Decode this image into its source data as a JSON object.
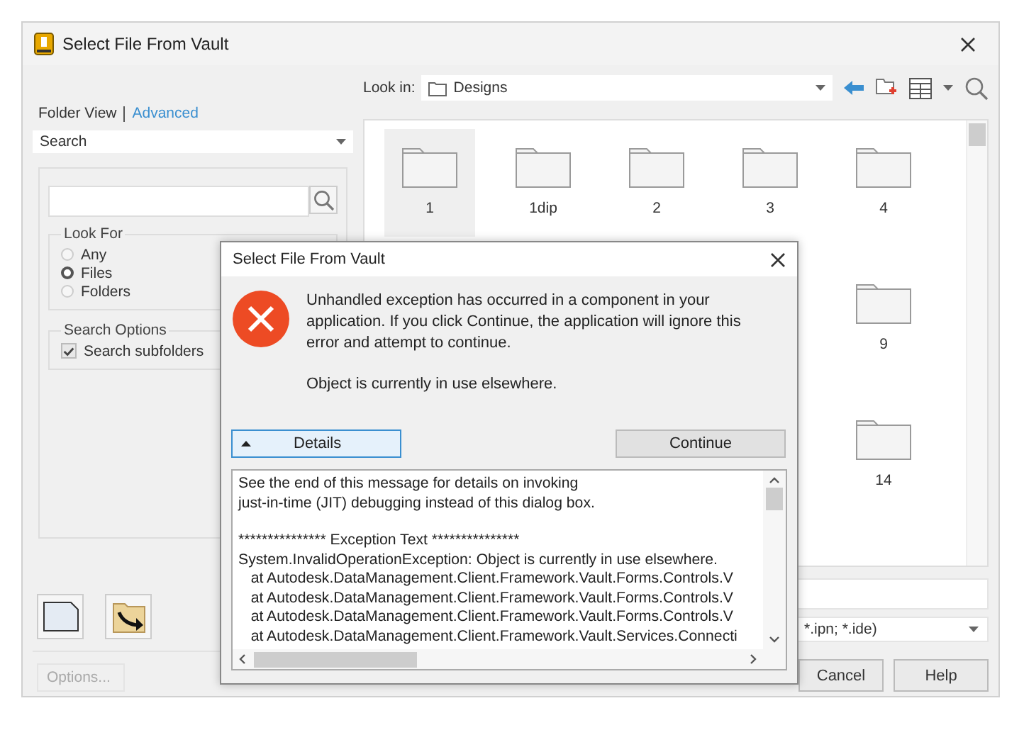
{
  "window": {
    "title": "Select File From Vault"
  },
  "left_panel": {
    "view_links": [
      {
        "label": "Folder View",
        "selected": true
      },
      {
        "label": "Advanced",
        "selected": false
      }
    ],
    "search_mode": "Search",
    "look_for": {
      "title": "Look For",
      "options": [
        {
          "label": "Any",
          "selected": false
        },
        {
          "label": "Files",
          "selected": true
        },
        {
          "label": "Folders",
          "selected": false
        }
      ]
    },
    "search_options": {
      "title": "Search Options",
      "options": [
        {
          "label": "Search subfolders",
          "checked": true
        }
      ]
    },
    "options_button": {
      "label": "Options...",
      "disabled": true
    }
  },
  "look_in": {
    "label": "Look in:",
    "value": "Designs"
  },
  "folders": [
    {
      "name": "1",
      "selected": true
    },
    {
      "name": "1dip",
      "selected": false
    },
    {
      "name": "2",
      "selected": false
    },
    {
      "name": "3",
      "selected": false
    },
    {
      "name": "4",
      "selected": false
    },
    {
      "name": "9",
      "selected": false
    },
    {
      "name": "14",
      "selected": false
    }
  ],
  "file_type": {
    "value": "*.ipn; *.ide)"
  },
  "buttons": [
    {
      "label": "Cancel"
    },
    {
      "label": "Help"
    }
  ],
  "dialog": {
    "title": "Select File From Vault",
    "message": [
      "Unhandled exception has occurred in a component in your application. If you click Continue, the application will ignore this error and attempt to continue.",
      "Object is currently in use elsewhere."
    ],
    "details_button": {
      "label": "Details",
      "expanded": true
    },
    "continue_button": {
      "label": "Continue"
    },
    "details_text": [
      [
        "See the end of this message for details on invoking",
        "just-in-time (JIT) debugging instead of this dialog box."
      ],
      [
        "*************** Exception Text ***************",
        "System.InvalidOperationException: Object is currently in use elsewhere.",
        "   at Autodesk.DataManagement.Client.Framework.Vault.Forms.Controls.V",
        "   at Autodesk.DataManagement.Client.Framework.Vault.Forms.Controls.V",
        "   at Autodesk.DataManagement.Client.Framework.Vault.Forms.Controls.V",
        "   at Autodesk.DataManagement.Client.Framework.Vault.Services.Connecti"
      ]
    ]
  }
}
